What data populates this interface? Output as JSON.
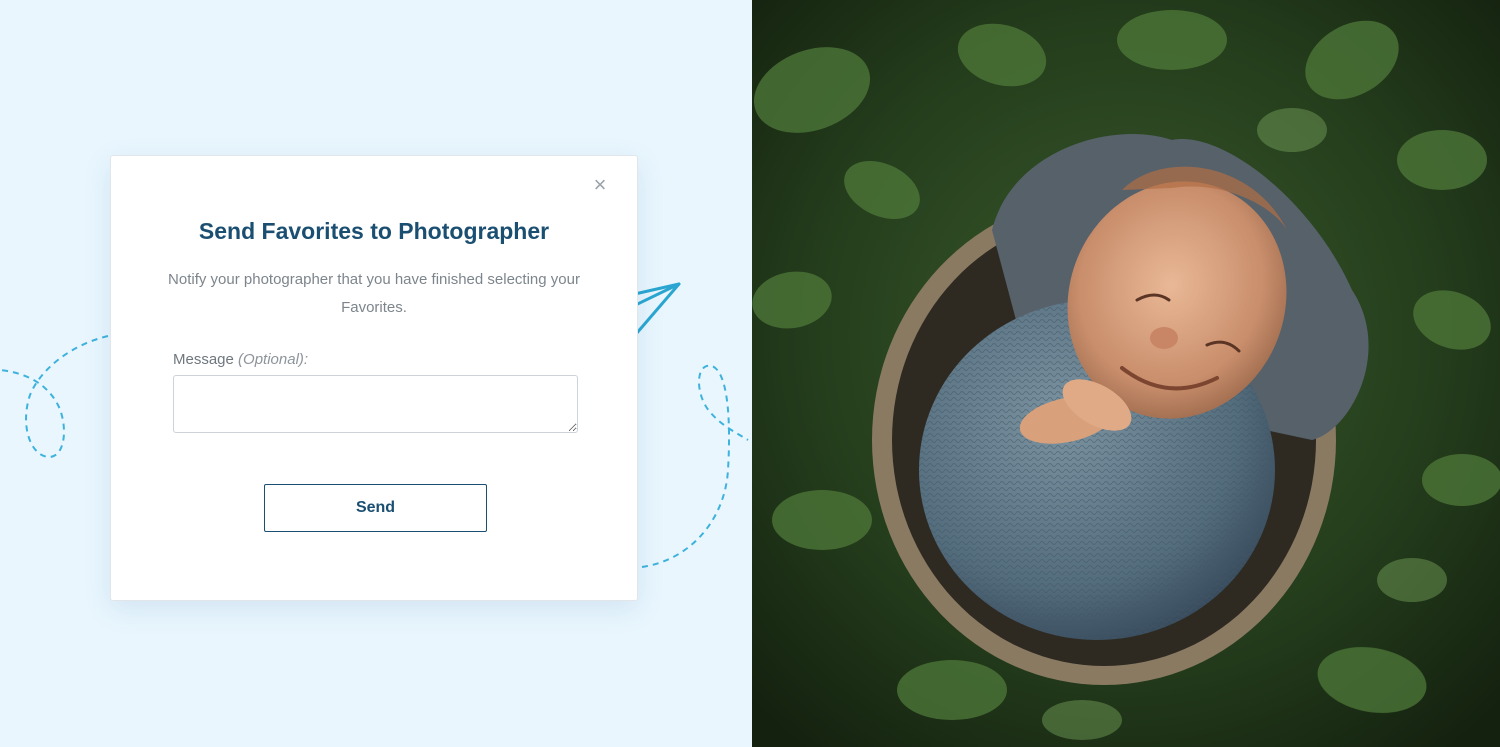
{
  "modal": {
    "title": "Send Favorites to Photographer",
    "description": "Notify your photographer that you have finished selecting your Favorites.",
    "message_label": "Message",
    "message_label_optional": "(Optional):",
    "message_value": "",
    "message_placeholder": "",
    "send_label": "Send",
    "close_glyph": "×"
  },
  "icons": {
    "close": "close-icon",
    "send_decoration": "paper-airplane-icon"
  },
  "photo": {
    "subject": "newborn-baby-photo"
  },
  "colors": {
    "background": "#e9f6fe",
    "title": "#1b4f72",
    "accent": "#2aa6d1"
  }
}
